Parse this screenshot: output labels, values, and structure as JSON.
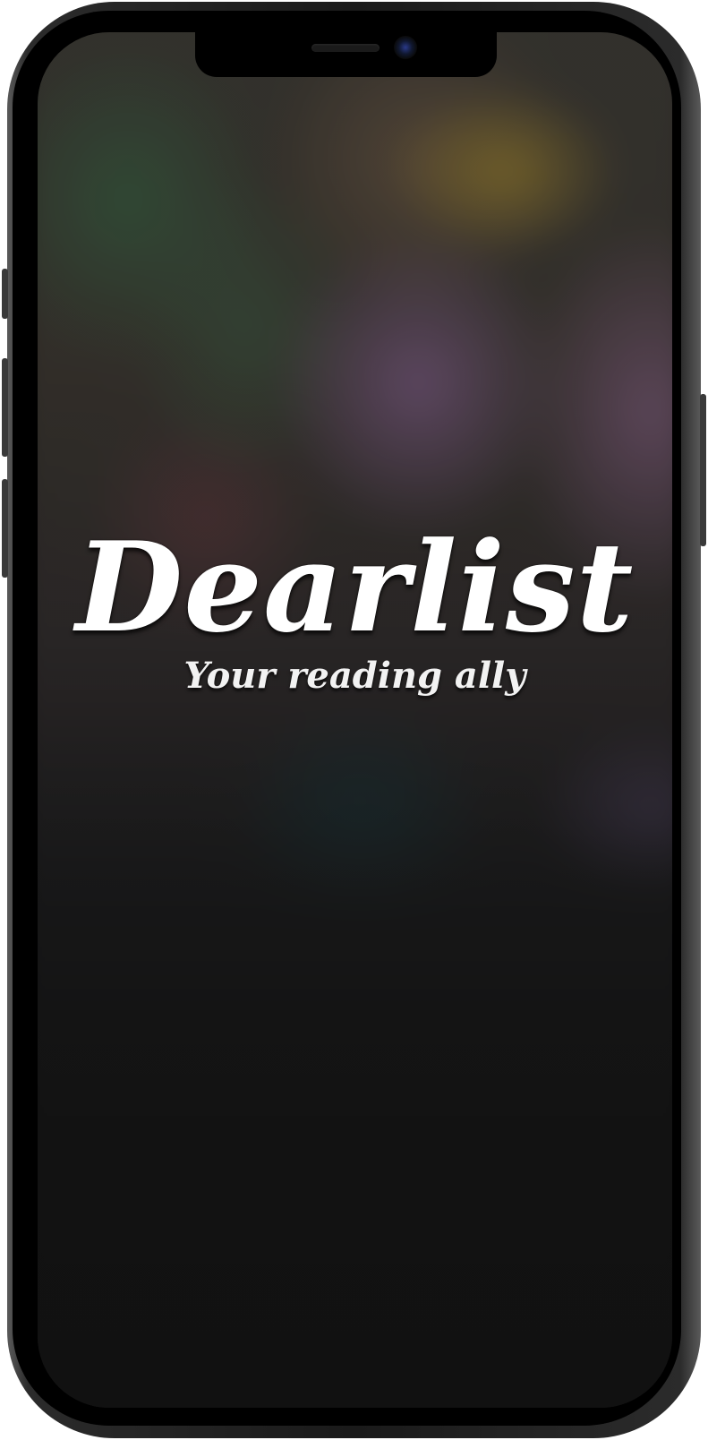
{
  "app": {
    "title": "Dearlist",
    "tagline": "Your reading ally"
  },
  "device": {
    "frame_color": "#1a1a1a",
    "screen_bg": "#111111"
  },
  "icons": {
    "camera": "front-camera-icon",
    "speaker": "earpiece-speaker-icon"
  }
}
